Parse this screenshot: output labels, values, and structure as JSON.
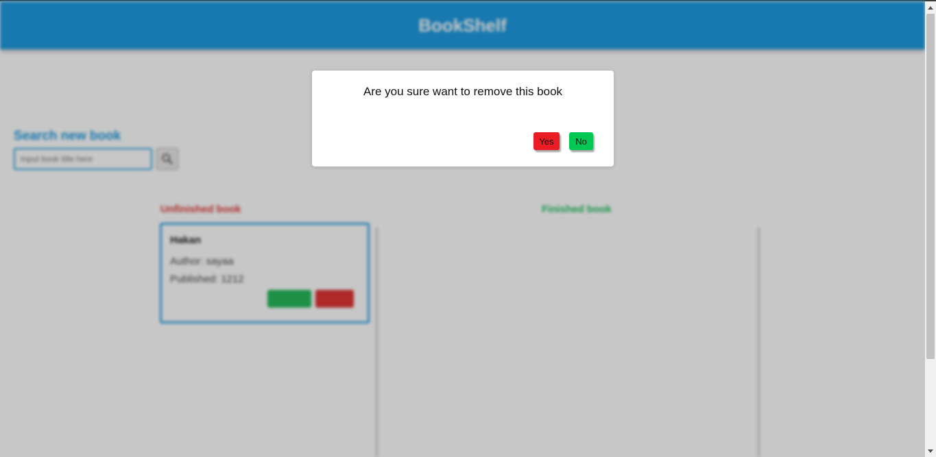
{
  "app": {
    "title": "BookShelf"
  },
  "search": {
    "title": "Search new book",
    "placeholder": "Input book title here"
  },
  "columns": {
    "unfinished_title": "Unfinished book",
    "finished_title": "Finished book"
  },
  "books_unfinished": [
    {
      "title": "Hakan",
      "author": "Author: sayaa",
      "published": "Published: 1212"
    }
  ],
  "modal": {
    "message": "Are you sure want to remove this book",
    "yes_label": "Yes",
    "no_label": "No"
  },
  "colors": {
    "header": "#1e9be0",
    "unfinished": "#e03a3a",
    "finished": "#1ec060",
    "yes_button": "#ec1c24",
    "no_button": "#00c853"
  },
  "icons": {
    "search_button": "search-icon"
  }
}
